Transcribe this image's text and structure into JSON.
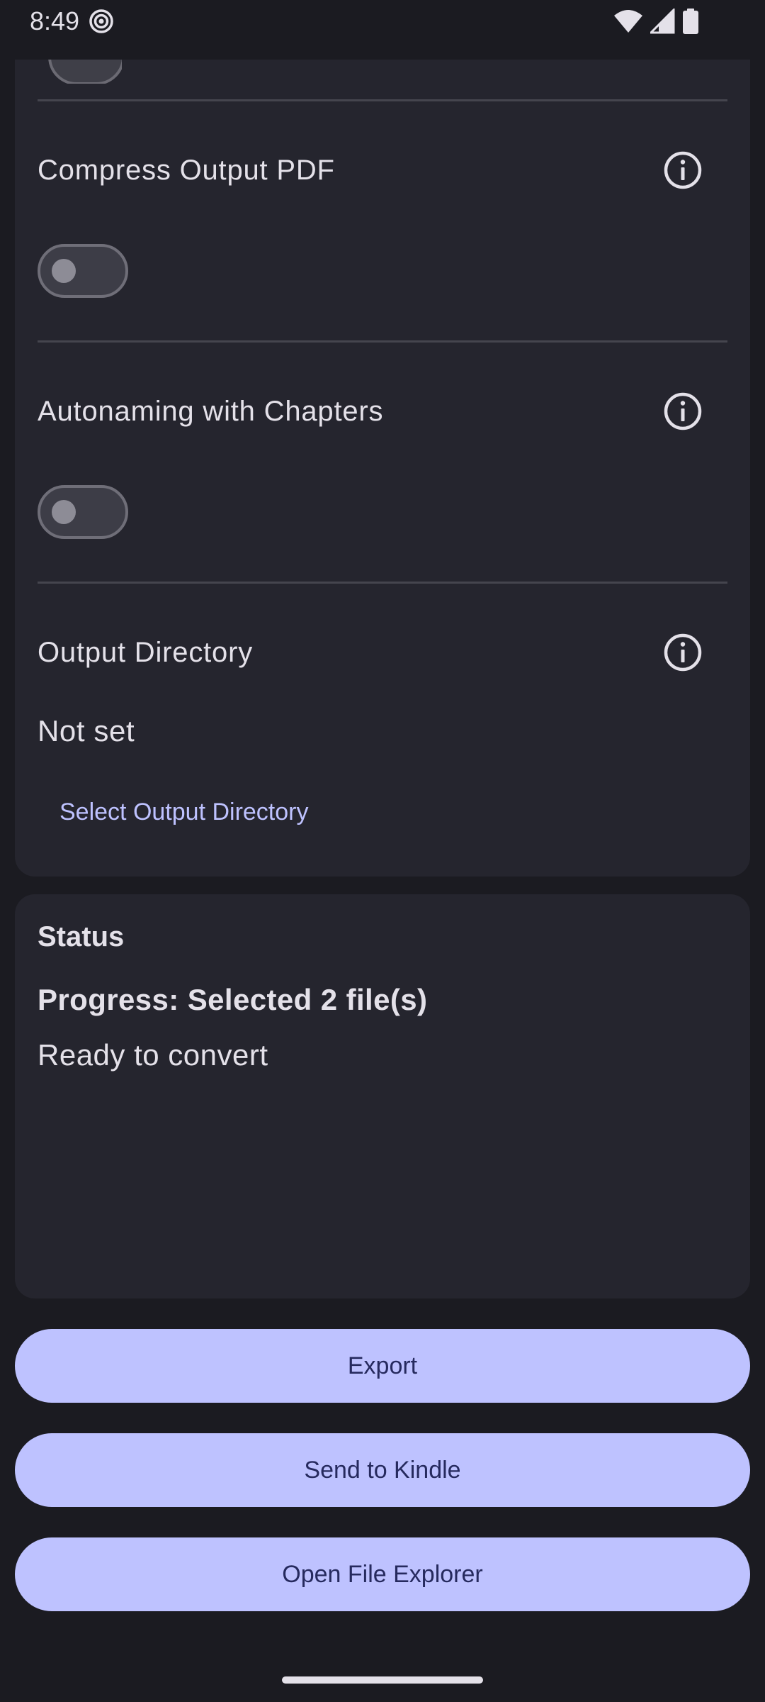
{
  "status_bar": {
    "time": "8:49",
    "icons": [
      "app-notification-icon",
      "wifi-icon",
      "signal-icon",
      "battery-icon"
    ]
  },
  "settings": {
    "compress": {
      "title": "Compress Output PDF",
      "enabled": false
    },
    "autonaming": {
      "title": "Autonaming with Chapters",
      "enabled": false
    },
    "output_directory": {
      "title": "Output Directory",
      "value": "Not set",
      "button_label": "Select Output Directory"
    }
  },
  "status": {
    "title": "Status",
    "progress": "Progress: Selected 2 file(s)",
    "message": "Ready to convert"
  },
  "actions": {
    "export": "Export",
    "send_to_kindle": "Send to Kindle",
    "open_file_explorer": "Open File Explorer"
  },
  "colors": {
    "background": "#1b1b21",
    "card": "#25252e",
    "accent": "#bec2ff",
    "on_accent": "#262a5e",
    "text": "#e4e1e9"
  }
}
